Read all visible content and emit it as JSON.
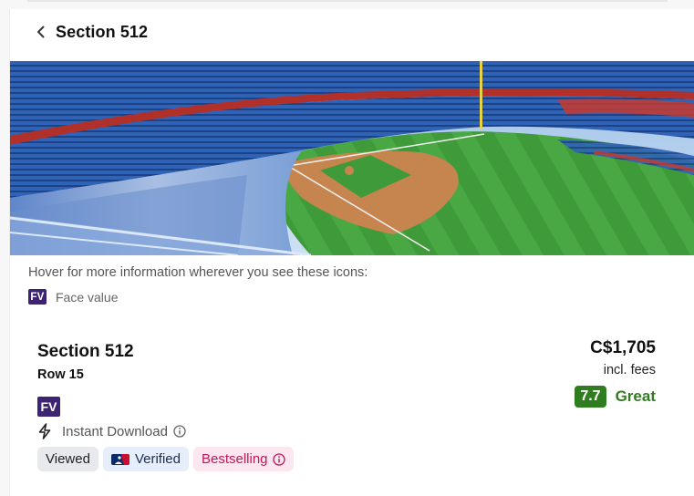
{
  "header": {
    "title": "Section 512"
  },
  "hint": {
    "text": "Hover for more information wherever you see these icons:",
    "fv_badge": "FV",
    "fv_label": "Face value"
  },
  "listing": {
    "section": "Section 512",
    "row": "Row 15",
    "fv_badge": "FV",
    "delivery": "Instant Download",
    "badges": {
      "viewed": "Viewed",
      "verified": "Verified",
      "bestselling": "Bestselling"
    },
    "price": "C$1,705",
    "fees": "incl. fees",
    "score": "7.7",
    "score_label": "Great"
  },
  "colors": {
    "accent_purple": "#3f2373",
    "score_green": "#2f7d1e",
    "bestselling_pink": "#c0185a",
    "seat_blue": "#2e63b8",
    "field_green": "#3f9b3a"
  },
  "icons": [
    "chevron-left-icon",
    "bolt-icon",
    "info-icon",
    "mlb-logo-icon"
  ]
}
